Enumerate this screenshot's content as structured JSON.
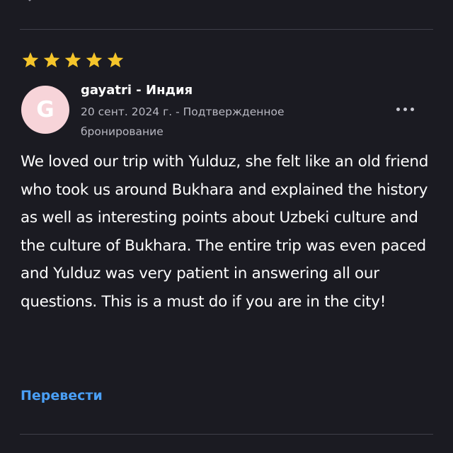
{
  "review": {
    "rating": 5,
    "rating_max": 5,
    "reviewer": {
      "initial": "G",
      "name": "gayatri - Индия",
      "meta": "20 сент. 2024 г. - Подтвержденное бронирование"
    },
    "text": "We loved our trip with Yulduz, she felt like an old friend who took us around Bukhara and explained the history as well as interesting points about Uzbeki culture and the culture of Bukhara. The entire trip was even paced and Yulduz was very patient in answering all our questions. This is a must do if you are in the city!",
    "translate_label": "Перевести"
  },
  "icons": {
    "star": "star-icon",
    "more": "more-options-icon",
    "arrow": "arrow-icon"
  },
  "colors": {
    "background": "#1b1b22",
    "star": "#f5c52b",
    "avatar_bg": "#f7d4d9",
    "link": "#4a9ff5",
    "meta_text": "#b9b9c3",
    "divider": "#3f3f49"
  }
}
